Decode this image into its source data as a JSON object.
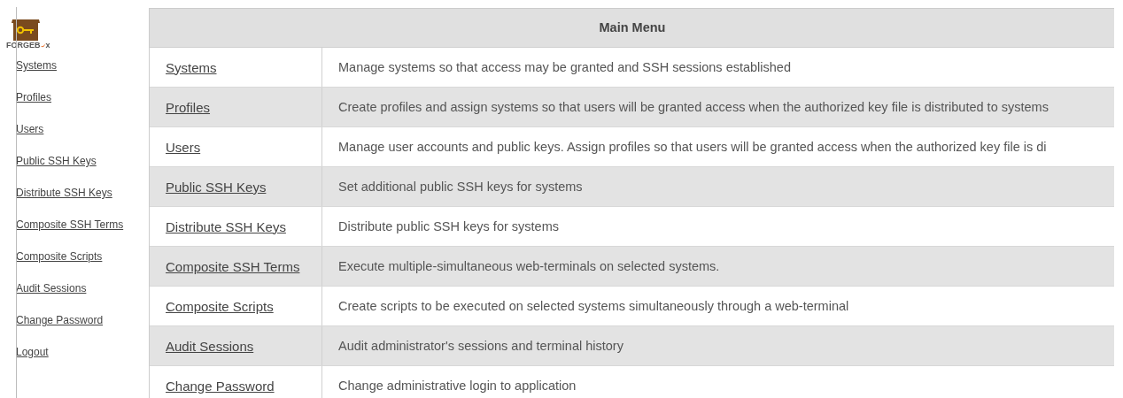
{
  "logo": {
    "text_before": "FORGEB",
    "text_after": "x"
  },
  "sidebar": {
    "items": [
      {
        "label": "Systems"
      },
      {
        "label": "Profiles"
      },
      {
        "label": "Users"
      },
      {
        "label": "Public SSH Keys"
      },
      {
        "label": "Distribute SSH Keys"
      },
      {
        "label": "Composite SSH Terms"
      },
      {
        "label": "Composite Scripts"
      },
      {
        "label": "Audit Sessions"
      },
      {
        "label": "Change Password"
      },
      {
        "label": "Logout"
      }
    ]
  },
  "table": {
    "title": "Main Menu",
    "rows": [
      {
        "link": "Systems",
        "description": "Manage systems so that access may be granted and SSH sessions established"
      },
      {
        "link": "Profiles",
        "description": "Create profiles and assign systems so that users will be granted access when the authorized key file is distributed to systems"
      },
      {
        "link": "Users",
        "description": "Manage user accounts and public keys. Assign profiles so that users will be granted access when the authorized key file is di"
      },
      {
        "link": "Public SSH Keys",
        "description": "Set additional public SSH keys for systems"
      },
      {
        "link": "Distribute SSH Keys",
        "description": "Distribute public SSH keys for systems"
      },
      {
        "link": "Composite SSH Terms",
        "description": "Execute multiple-simultaneous web-terminals on selected systems."
      },
      {
        "link": "Composite Scripts",
        "description": "Create scripts to be executed on selected systems simultaneously through a web-terminal"
      },
      {
        "link": "Audit Sessions",
        "description": "Audit administrator's sessions and terminal history"
      },
      {
        "link": "Change Password",
        "description": "Change administrative login to application"
      }
    ]
  }
}
